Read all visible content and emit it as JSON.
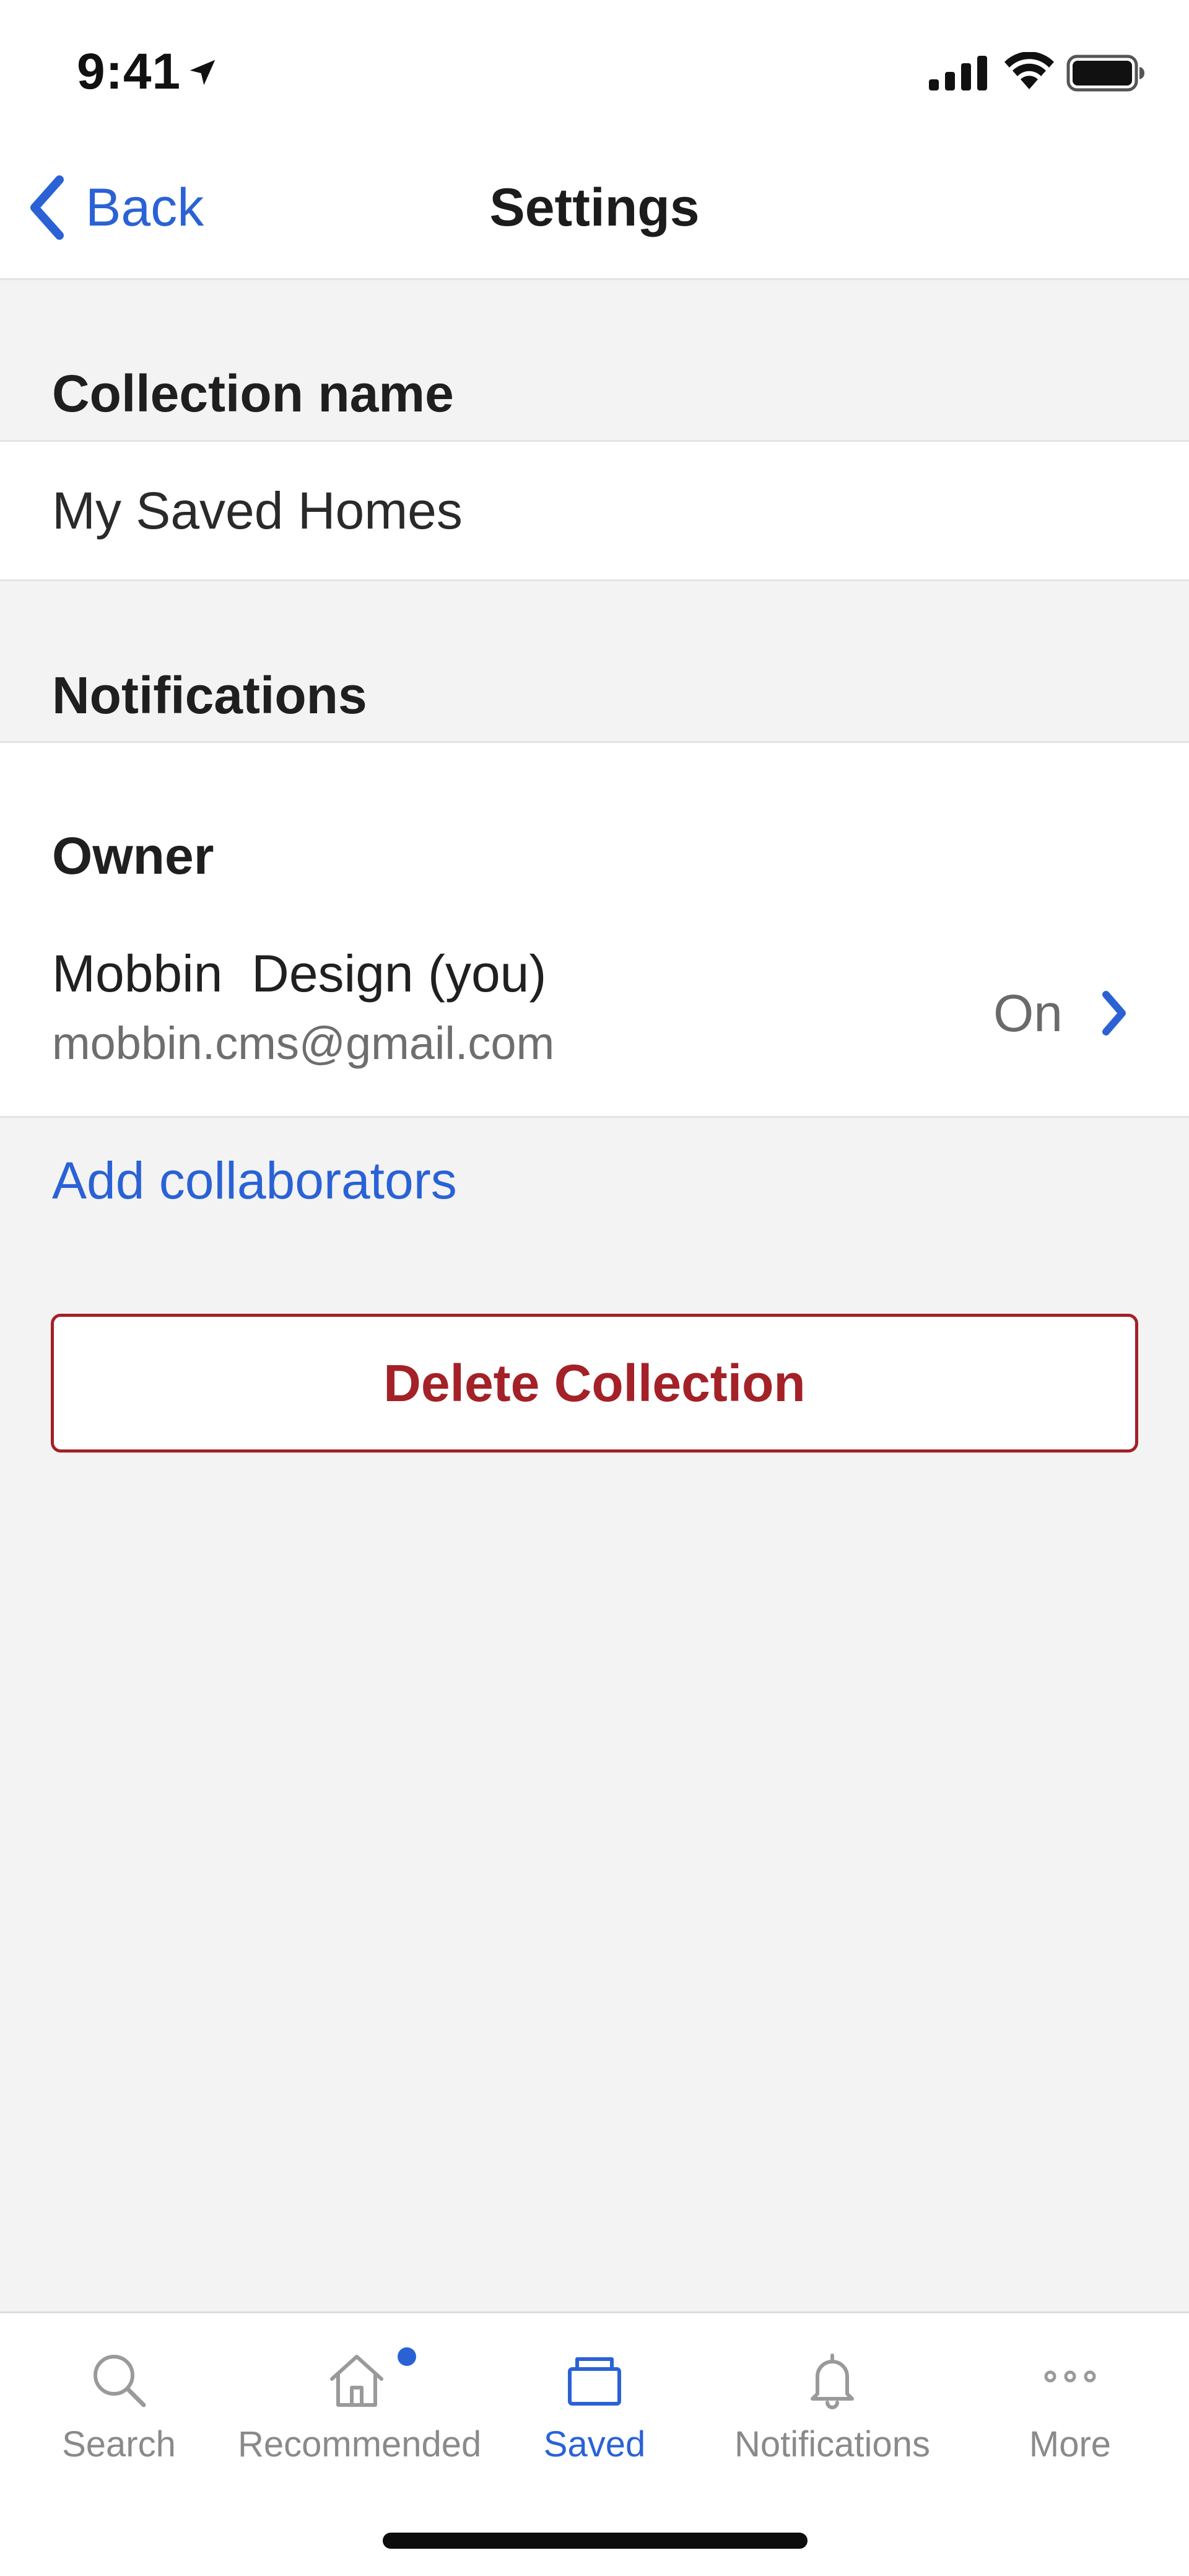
{
  "status_bar": {
    "time": "9:41"
  },
  "nav": {
    "back_label": "Back",
    "title": "Settings"
  },
  "collection_name": {
    "header": "Collection name",
    "value": "My Saved Homes"
  },
  "notifications": {
    "header": "Notifications",
    "owner_label": "Owner",
    "owner": {
      "name": "Mobbin  Design (you)",
      "email": "mobbin.cms@gmail.com",
      "status": "On"
    }
  },
  "collaborators": {
    "add_label": "Add collaborators"
  },
  "delete": {
    "label": "Delete Collection"
  },
  "tab_bar": {
    "active": "Saved",
    "items": [
      {
        "label": "Search",
        "icon": "search-icon"
      },
      {
        "label": "Recommended",
        "icon": "home-icon",
        "badge": true
      },
      {
        "label": "Saved",
        "icon": "folder-icon"
      },
      {
        "label": "Notifications",
        "icon": "bell-icon"
      },
      {
        "label": "More",
        "icon": "more-icon"
      }
    ]
  },
  "colors": {
    "accent": "#2a62d6",
    "danger": "#a32127",
    "background": "#f3f3f3",
    "inactive": "#8a8a8a"
  }
}
